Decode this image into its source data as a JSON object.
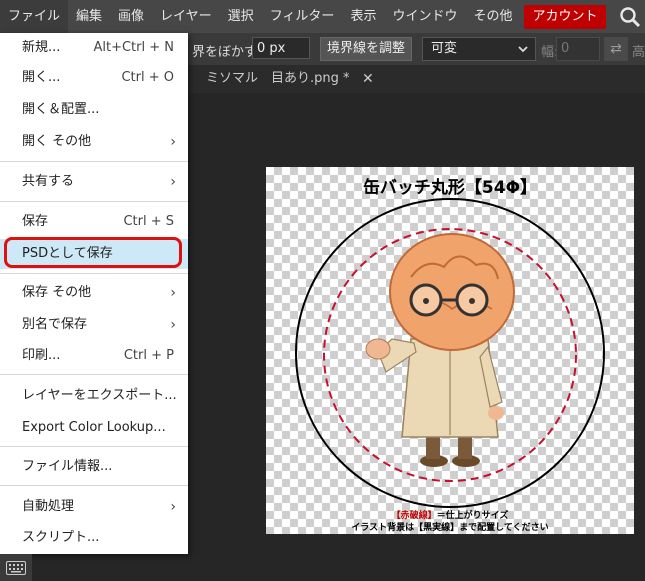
{
  "menubar": {
    "items": [
      "ファイル",
      "編集",
      "画像",
      "レイヤー",
      "選択",
      "フィルター",
      "表示",
      "ウインドウ",
      "その他"
    ],
    "account": "アカウント"
  },
  "options": {
    "blur_label": "界をぼかす:",
    "blur_value": "0 px",
    "refine_edge": "境界線を調整",
    "mode_value": "可変",
    "width_label": "幅:",
    "width_value": "0",
    "height_label": "高"
  },
  "tabs": {
    "title": "ミソマル　目あり.png *",
    "close": "✕"
  },
  "canvas": {
    "title": "缶バッチ丸形【54Φ】",
    "note_red": "【赤破線】",
    "note_rest": "＝仕上がりサイズ",
    "note2": "イラスト背景は【黒実線】まで配置してください"
  },
  "file_menu": {
    "items": [
      {
        "label": "新規...",
        "shortcut": "Alt+Ctrl + N"
      },
      {
        "label": "開く...",
        "shortcut": "Ctrl + O"
      },
      {
        "label": "開く＆配置...",
        "shortcut": ""
      },
      {
        "label": "開く その他",
        "shortcut": "",
        "submenu": true
      },
      {
        "label": "共有する",
        "shortcut": "",
        "submenu": true
      },
      {
        "label": "保存",
        "shortcut": "Ctrl + S"
      },
      {
        "label": "PSDとして保存",
        "shortcut": "",
        "highlighted": true
      },
      {
        "label": "保存 その他",
        "shortcut": "",
        "submenu": true
      },
      {
        "label": "別名で保存",
        "shortcut": "",
        "submenu": true
      },
      {
        "label": "印刷...",
        "shortcut": "Ctrl + P"
      },
      {
        "label": "レイヤーをエクスポート...",
        "shortcut": ""
      },
      {
        "label": "Export Color Lookup...",
        "shortcut": ""
      },
      {
        "label": "ファイル情報...",
        "shortcut": ""
      },
      {
        "label": "自動処理",
        "shortcut": "",
        "submenu": true
      },
      {
        "label": "スクリプト...",
        "shortcut": ""
      }
    ]
  },
  "colors": {
    "accent_red": "#c00000",
    "highlight": "#cde8f6",
    "annotation_red": "#e01010"
  }
}
